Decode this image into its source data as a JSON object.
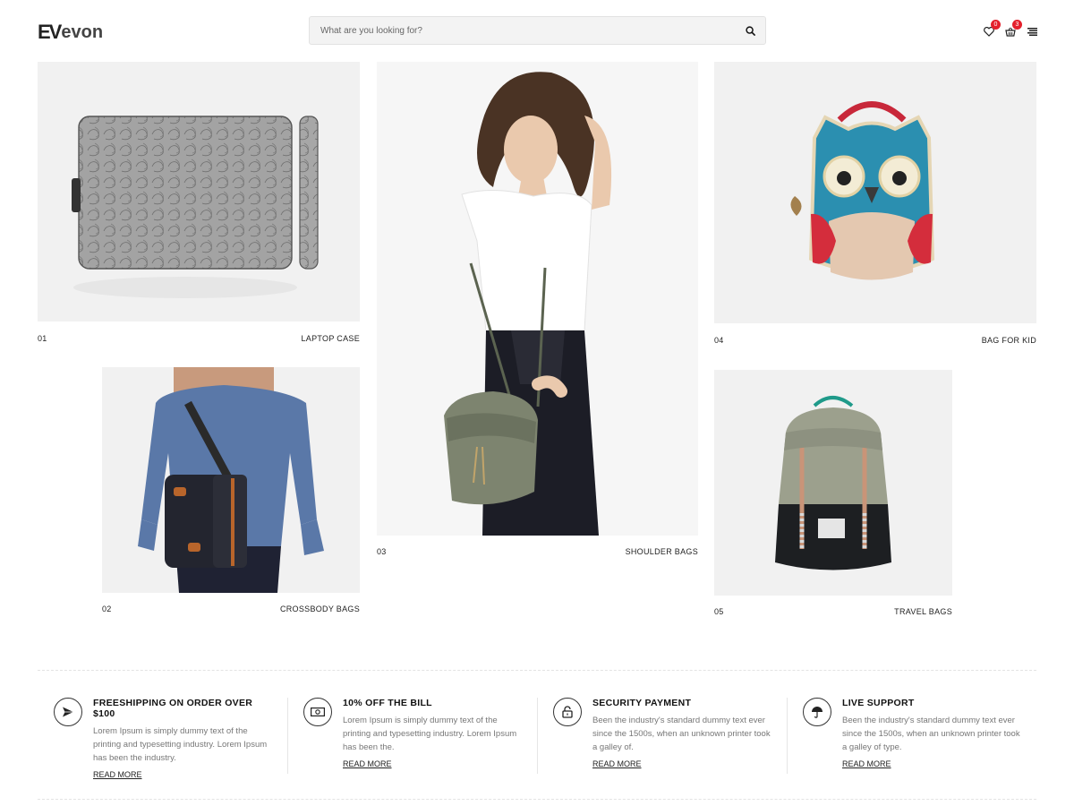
{
  "brand": {
    "mark": "EV",
    "rest": "evon"
  },
  "search": {
    "placeholder": "What are you looking for?"
  },
  "header": {
    "wishlist_count": "0",
    "cart_count": "3"
  },
  "products": [
    {
      "number": "01",
      "name": "LAPTOP CASE"
    },
    {
      "number": "02",
      "name": "CROSSBODY BAGS"
    },
    {
      "number": "03",
      "name": "SHOULDER BAGS"
    },
    {
      "number": "04",
      "name": "BAG FOR KID"
    },
    {
      "number": "05",
      "name": "TRAVEL BAGS"
    }
  ],
  "features": [
    {
      "icon": "airplane-icon",
      "title": "FREESHIPPING ON ORDER OVER $100",
      "text": "Lorem Ipsum is simply dummy text of the printing and typesetting industry. Lorem Ipsum has been the industry.",
      "link": "READ MORE"
    },
    {
      "icon": "money-icon",
      "title": "10% OFF THE BILL",
      "text": "Lorem Ipsum is simply dummy text of the printing and typesetting industry. Lorem Ipsum has been the.",
      "link": "READ MORE"
    },
    {
      "icon": "lock-icon",
      "title": "SECURITY PAYMENT",
      "text": "Been the industry's standard dummy text ever since the 1500s, when an unknown printer took a galley of.",
      "link": "READ MORE"
    },
    {
      "icon": "umbrella-icon",
      "title": "LIVE SUPPORT",
      "text": "Been the industry's standard dummy text ever since the 1500s, when an unknown printer took a galley of type.",
      "link": "READ MORE"
    }
  ],
  "colors": {
    "badge": "#e4202c",
    "tile_bg": "#f1f1f1",
    "text": "#222222",
    "muted": "#777777"
  }
}
